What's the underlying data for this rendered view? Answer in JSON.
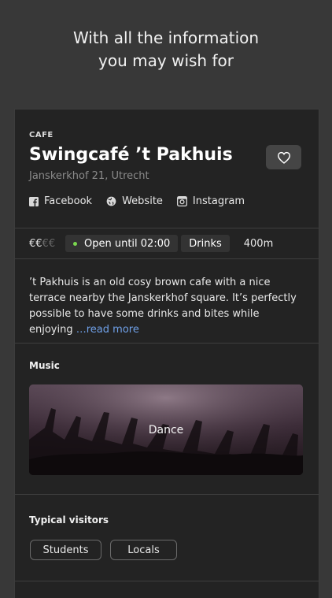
{
  "hero": {
    "line1": "With all the information",
    "line2": "you may wish for"
  },
  "venue": {
    "category": "CAFE",
    "name": "Swingcafé ’t Pakhuis",
    "address": "Janskerkhof 21, Utrecht",
    "favorite_icon": "heart-outline-icon"
  },
  "links": [
    {
      "label": "Facebook",
      "icon": "facebook-icon"
    },
    {
      "label": "Website",
      "icon": "globe-icon"
    },
    {
      "label": "Instagram",
      "icon": "instagram-icon"
    }
  ],
  "info": {
    "price_active": "€€",
    "price_inactive": "€€",
    "open_status": "Open until 02:00",
    "type": "Drinks",
    "distance": "400m",
    "status_color": "#7bd84f"
  },
  "description": {
    "text": "’t Pakhuis is an old cosy brown cafe with a nice terrace nearby the Janskerkhof square. It’s perfectly possible to have some drinks and bites while enjoying",
    "more": "…read more"
  },
  "music": {
    "heading": "Music",
    "genre": "Dance"
  },
  "visitors": {
    "heading": "Typical visitors",
    "tags": [
      "Students",
      "Locals"
    ]
  }
}
